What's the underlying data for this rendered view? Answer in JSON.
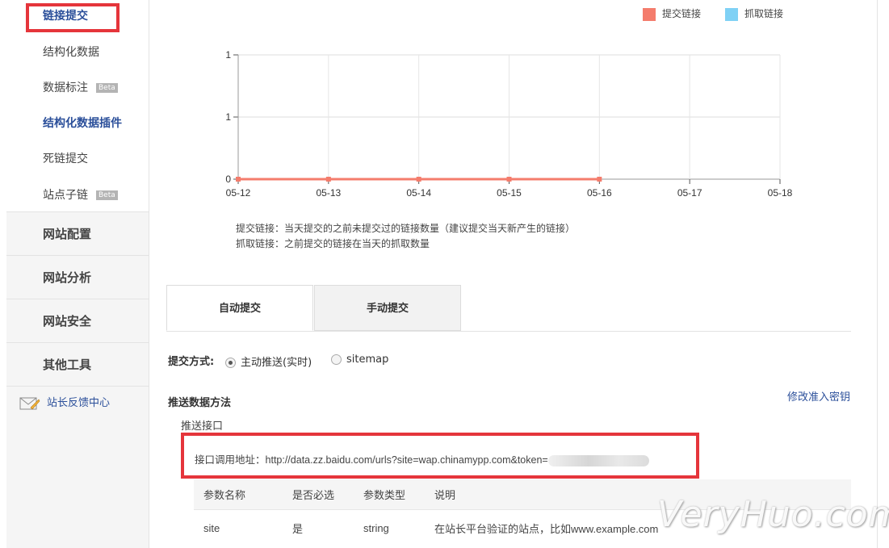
{
  "sidebar": {
    "items": [
      {
        "label": "链接提交",
        "badge": ""
      },
      {
        "label": "结构化数据",
        "badge": ""
      },
      {
        "label": "数据标注",
        "badge": "Beta"
      },
      {
        "label": "结构化数据插件",
        "badge": ""
      },
      {
        "label": "死链提交",
        "badge": ""
      },
      {
        "label": "站点子链",
        "badge": "Beta"
      }
    ],
    "sections": [
      "网站配置",
      "网站分析",
      "网站安全",
      "其他工具"
    ],
    "feedback": "站长反馈中心"
  },
  "legend": {
    "submit": "提交链接",
    "crawl": "抓取链接",
    "submit_color": "#f47c6c",
    "crawl_color": "#7fd1f5"
  },
  "chart_data": {
    "type": "line",
    "x": [
      "05-12",
      "05-13",
      "05-14",
      "05-15",
      "05-16",
      "05-17",
      "05-18"
    ],
    "y_ticks": [
      "0",
      "1",
      "1"
    ],
    "series": [
      {
        "name": "提交链接",
        "color": "#f47c6c",
        "values": [
          0,
          0,
          0,
          0,
          0
        ]
      }
    ],
    "grid": true
  },
  "notes": {
    "line1": "提交链接：当天提交的之前未提交过的链接数量（建议提交当天新产生的链接）",
    "line2": "抓取链接：之前提交的链接在当天的抓取数量"
  },
  "tabs": [
    "自动提交",
    "手动提交"
  ],
  "submit_method": {
    "label": "提交方式:",
    "options": [
      "主动推送(实时)",
      "sitemap"
    ],
    "selected": "主动推送(实时)"
  },
  "push": {
    "title": "推送数据方法",
    "modify_key": "修改准入密钥",
    "interface": "推送接口",
    "api_label": "接口调用地址：",
    "api_url": "http://data.zz.baidu.com/urls?site=wap.chinamypp.com&token="
  },
  "params_table": {
    "headers": [
      "参数名称",
      "是否必选",
      "参数类型",
      "说明"
    ],
    "rows": [
      [
        "site",
        "是",
        "string",
        "在站长平台验证的站点，比如www.example.com"
      ]
    ]
  },
  "watermark": "VeryHuo.com"
}
